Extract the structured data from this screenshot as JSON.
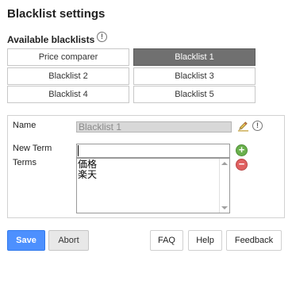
{
  "header": {
    "title": "Blacklist settings",
    "available_label": "Available blacklists",
    "info_glyph": "!"
  },
  "blacklists": [
    {
      "label": "Price comparer",
      "selected": false
    },
    {
      "label": "Blacklist 1",
      "selected": true
    },
    {
      "label": "Blacklist 2",
      "selected": false
    },
    {
      "label": "Blacklist 3",
      "selected": false
    },
    {
      "label": "Blacklist 4",
      "selected": false
    },
    {
      "label": "Blacklist 5",
      "selected": false
    }
  ],
  "form": {
    "name_label": "Name",
    "name_value": "Blacklist 1",
    "new_term_label": "New Term",
    "new_term_value": "",
    "terms_label": "Terms",
    "terms": [
      "価格",
      "楽天"
    ],
    "add_glyph": "+",
    "remove_glyph": "−"
  },
  "actions": {
    "save": "Save",
    "abort": "Abort",
    "faq": "FAQ",
    "help": "Help",
    "feedback": "Feedback"
  },
  "colors": {
    "primary": "#4d90fe",
    "selected_tab": "#707070",
    "add": "#6ab04c",
    "remove": "#e06060"
  },
  "icons": [
    "info-icon",
    "pencil-icon",
    "add-term-icon",
    "remove-term-icon"
  ]
}
